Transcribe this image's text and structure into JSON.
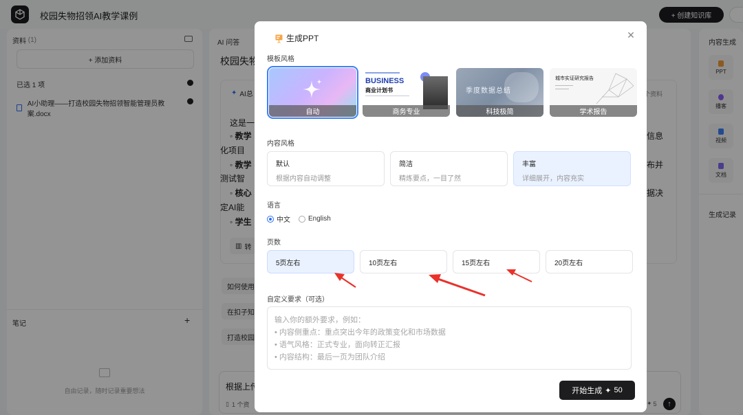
{
  "app": {
    "title": "校园失物招领AI教学课例",
    "create_kb": "+ 创建知识库"
  },
  "left": {
    "sources_title": "资料",
    "sources_count": "(1)",
    "add_source": "+ 添加资料",
    "selected": "已选 1 项",
    "file_name": "AI小助理——打造校园失物招领智能管理员教案.docx",
    "notes_title": "笔记",
    "notes_add": "+",
    "notes_empty": "自由记录，随时记录重要想法"
  },
  "middle": {
    "tab": "AI 问答",
    "title_fragment": "校园失物",
    "ai_badge": "AI总",
    "right_badge": "个资料",
    "para_start": "这是一",
    "lines": [
      {
        "bold": "◦ 教学",
        "tail": "信息"
      },
      {
        "plain": "化项目",
        "tail": ""
      },
      {
        "bold": "◦ 教学",
        "tail": "布并"
      },
      {
        "plain": "测试智",
        "tail": ""
      },
      {
        "bold": "◦ 核心",
        "tail": "据决"
      },
      {
        "plain": "定AI能",
        "tail": ""
      },
      {
        "bold": "◦ 学生",
        "tail": ""
      }
    ],
    "convert_chip": "转",
    "suggestions": [
      "如何使用",
      "在扣子知",
      "打造校园"
    ],
    "bottom_title": "根据上传",
    "bottom_sub": "1 个资",
    "bottom_count": "5"
  },
  "right": {
    "title": "内容生成",
    "items": [
      "PPT",
      "播客",
      "视频",
      "文档"
    ],
    "history": "生成记录"
  },
  "modal": {
    "title": "生成PPT",
    "template_label": "模板风格",
    "templates": [
      {
        "caption": "自动",
        "selected": true
      },
      {
        "caption": "商务专业",
        "headline": "BUSINESS",
        "sub": "商业计划书",
        "selected": false
      },
      {
        "caption": "科技极简",
        "overlay_text": "季度数据总结",
        "selected": false
      },
      {
        "caption": "学术报告",
        "heading": "城市实证研究报告",
        "selected": false
      }
    ],
    "content_style_label": "内容风格",
    "content_styles": [
      {
        "title": "默认",
        "desc": "根据内容自动调整",
        "selected": false
      },
      {
        "title": "简洁",
        "desc": "精炼要点，一目了然",
        "selected": false
      },
      {
        "title": "丰富",
        "desc": "详细展开，内容充实",
        "selected": true
      }
    ],
    "language_label": "语言",
    "languages": [
      {
        "label": "中文",
        "selected": true
      },
      {
        "label": "English",
        "selected": false
      }
    ],
    "pages_label": "页数",
    "pages": [
      {
        "label": "5页左右",
        "selected": true
      },
      {
        "label": "10页左右",
        "selected": false
      },
      {
        "label": "15页左右",
        "selected": false
      },
      {
        "label": "20页左右",
        "selected": false
      }
    ],
    "custom_label": "自定义要求（可选）",
    "custom_placeholder_lines": [
      "输入你的额外要求，例如：",
      "• 内容侧重点：重点突出今年的政策变化和市场数据",
      "• 语气风格：正式专业，面向转正汇报",
      "• 内容结构：最后一页为团队介绍"
    ],
    "generate_button": "开始生成",
    "generate_cost": "50"
  },
  "colors": {
    "accent": "#2b6ef5",
    "selected_bg": "#eaf2ff",
    "dark_button": "#1d1d1f",
    "arrow": "#e8322b"
  }
}
